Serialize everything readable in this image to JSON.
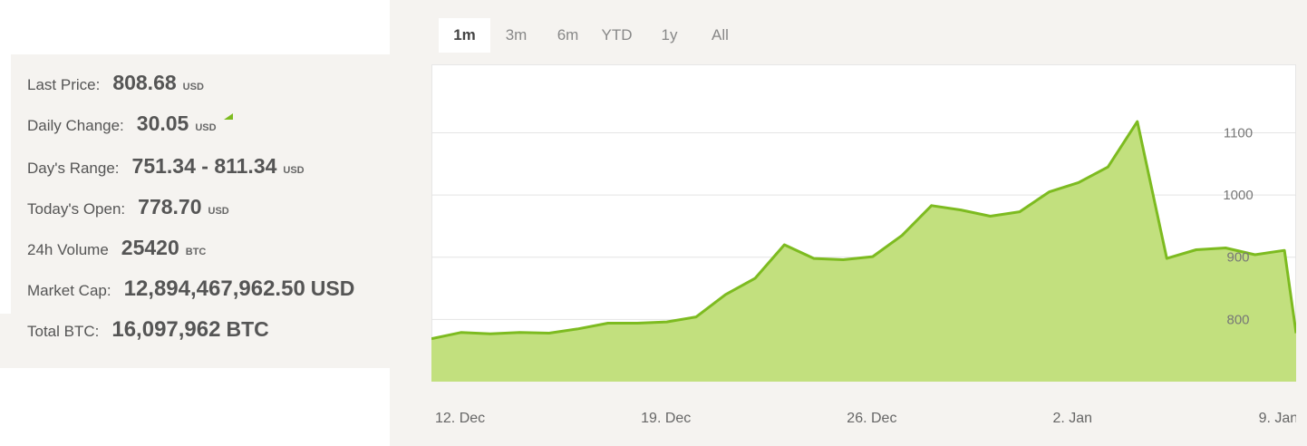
{
  "stats": {
    "last_price": {
      "label": "Last Price:",
      "value": "808.68",
      "unit": "USD"
    },
    "daily_change": {
      "label": "Daily Change:",
      "value": "30.05",
      "unit": "USD"
    },
    "days_range": {
      "label": "Day's Range:",
      "value": "751.34 - 811.34",
      "unit": "USD"
    },
    "todays_open": {
      "label": "Today's Open:",
      "value": "778.70",
      "unit": "USD"
    },
    "volume_24h": {
      "label": "24h Volume",
      "value": "25420",
      "unit": "BTC"
    },
    "market_cap": {
      "label": "Market Cap:",
      "value": "12,894,467,962.50",
      "unit": "USD"
    },
    "total_btc": {
      "label": "Total BTC:",
      "value": "16,097,962",
      "unit": "BTC"
    }
  },
  "tabs": [
    {
      "label": "1m",
      "active": true
    },
    {
      "label": "3m",
      "active": false
    },
    {
      "label": "6m",
      "active": false
    },
    {
      "label": "YTD",
      "active": false
    },
    {
      "label": "1y",
      "active": false
    },
    {
      "label": "All",
      "active": false
    }
  ],
  "colors": {
    "line": "#7dbb20",
    "fill": "#c2e07e",
    "flag_up": "#7dbb20",
    "grid": "#e4e4e4"
  },
  "chart_data": {
    "type": "area",
    "x_tick_labels": [
      "12. Dec",
      "19. Dec",
      "26. Dec",
      "2. Jan",
      "9. Jan"
    ],
    "x_tick_dates": [
      "2016-12-12",
      "2016-12-19",
      "2016-12-26",
      "2017-01-02",
      "2017-01-09"
    ],
    "y_ticks": [
      800,
      900,
      1000,
      1100
    ],
    "ylim": [
      700,
      1210
    ],
    "grid": true,
    "legend": "none",
    "title": "",
    "xlabel": "",
    "ylabel": "",
    "series": [
      {
        "dates": [
          "2016-12-12",
          "2016-12-13",
          "2016-12-14",
          "2016-12-15",
          "2016-12-16",
          "2016-12-17",
          "2016-12-18",
          "2016-12-19",
          "2016-12-20",
          "2016-12-21",
          "2016-12-22",
          "2016-12-23",
          "2016-12-24",
          "2016-12-25",
          "2016-12-26",
          "2016-12-27",
          "2016-12-28",
          "2016-12-29",
          "2016-12-30",
          "2016-12-31",
          "2017-01-01",
          "2017-01-02",
          "2017-01-03",
          "2017-01-04",
          "2017-01-05",
          "2017-01-06",
          "2017-01-07",
          "2017-01-08",
          "2017-01-09",
          "2017-01-10"
        ],
        "values": [
          769,
          779,
          777,
          779,
          778,
          785,
          794,
          794,
          796,
          804,
          840,
          866,
          920,
          898,
          896,
          901,
          935,
          983,
          976,
          966,
          973,
          1005,
          1020,
          1045,
          1118,
          898,
          912,
          915,
          904,
          911
        ],
        "final_partial": {
          "date": "2017-01-10T12:00",
          "value": 778
        }
      }
    ]
  }
}
